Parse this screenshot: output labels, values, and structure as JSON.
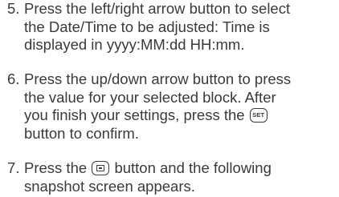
{
  "steps": [
    {
      "number": "5.",
      "lines": [
        "Press the left/right arrow button to select",
        "the Date/Time to be adjusted: Time is",
        "displayed in yyyy:MM:dd HH:mm."
      ]
    },
    {
      "number": "6.",
      "lines": [
        "Press the up/down arrow button to press",
        "the value for your selected block. After",
        "you finish your settings, press the"
      ],
      "key_label": "SET",
      "trail_line": "button to confirm."
    },
    {
      "number": "7.",
      "line1_before": "Press the",
      "line1_after": "button and the following",
      "line2": "snapshot screen appears."
    }
  ],
  "icons": {
    "set_key": "set-button-icon",
    "snapshot_key": "snapshot-button-icon"
  },
  "colors": {
    "text": "#3a3a3a",
    "background": "#ffffff"
  }
}
